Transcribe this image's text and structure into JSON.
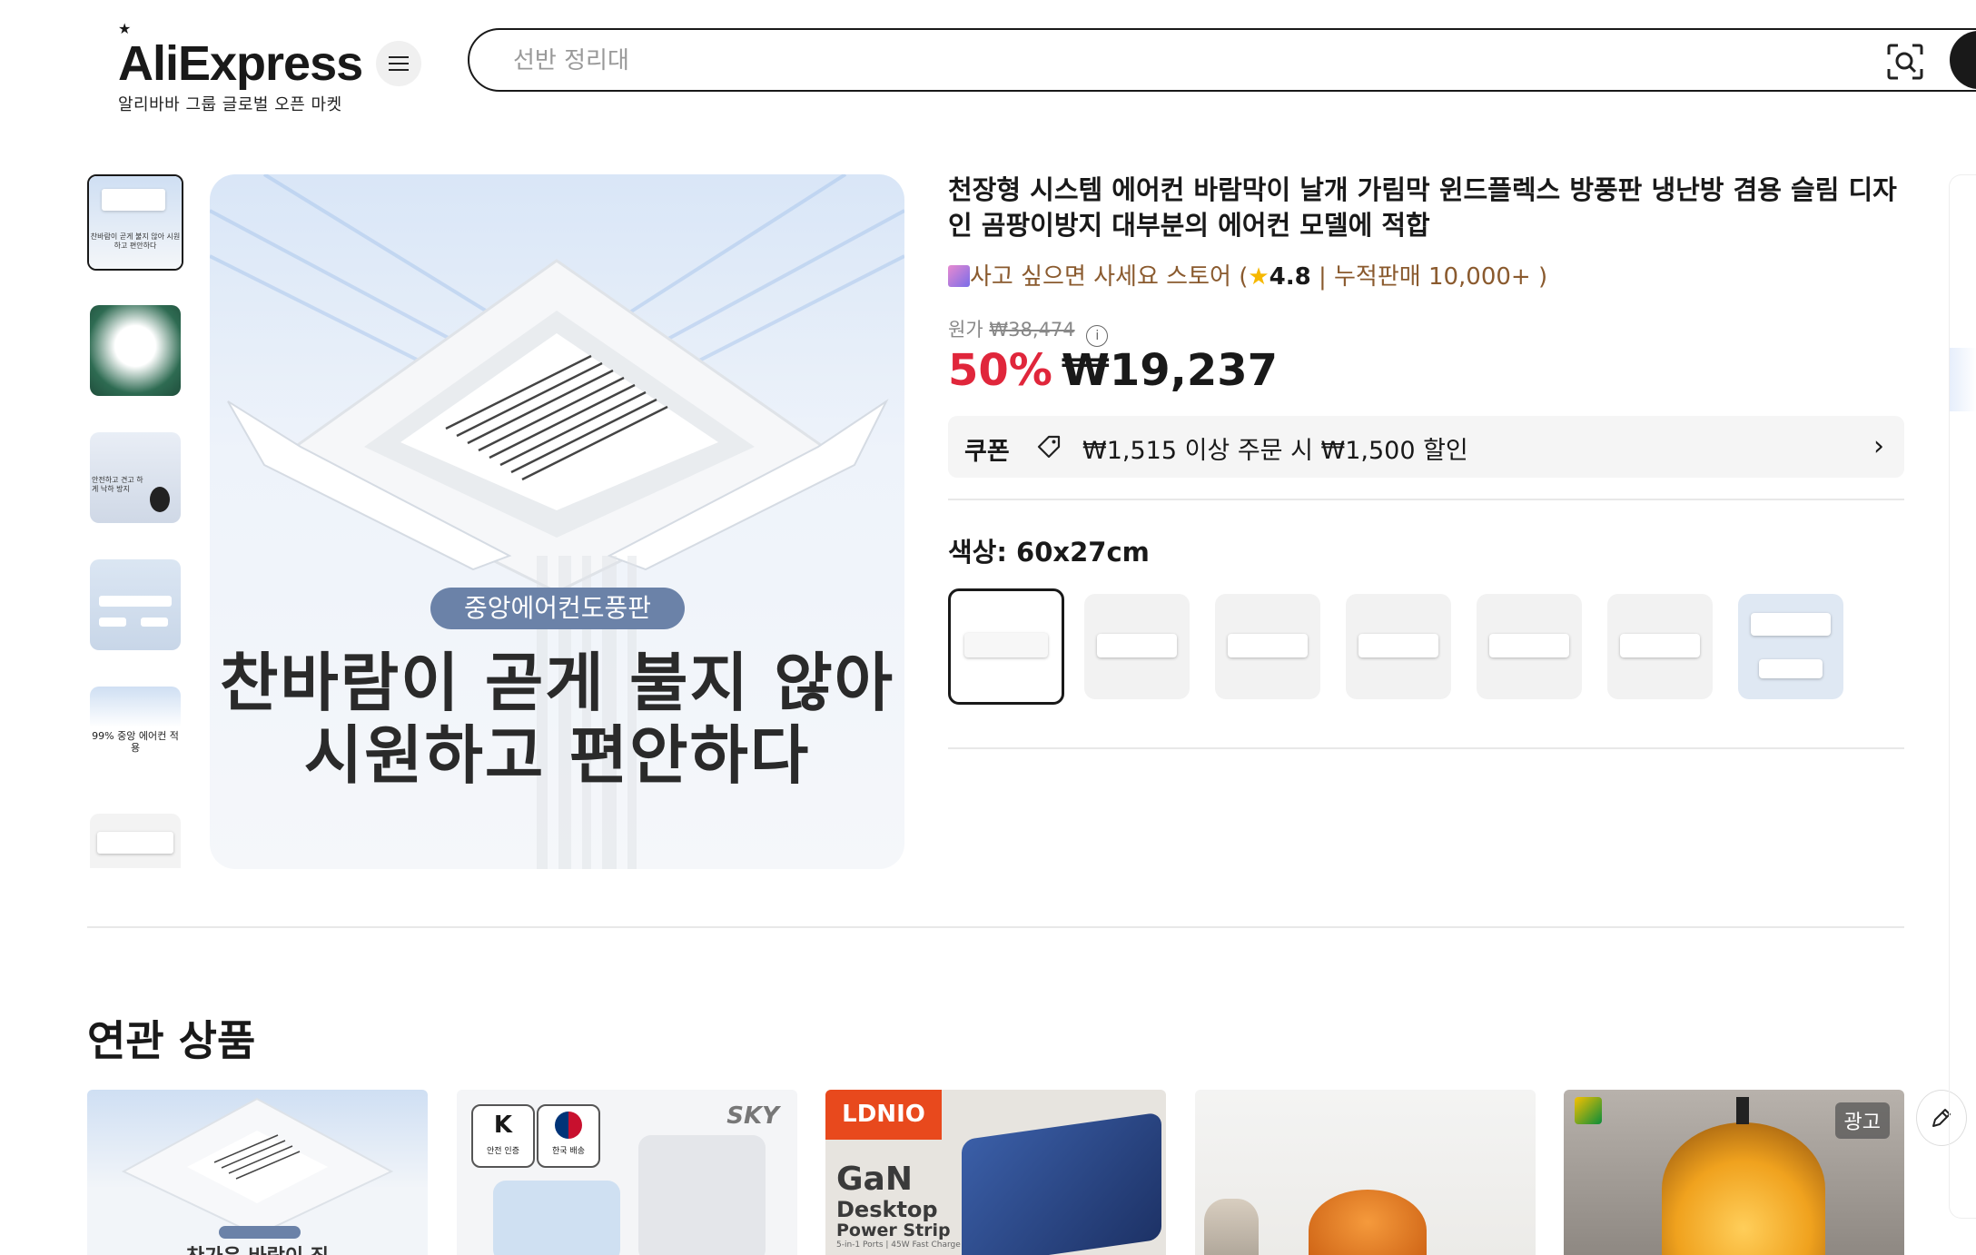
{
  "header": {
    "logo_text": "AliExpress",
    "logo_subtitle": "알리바바 그룹 글로벌 오픈 마켓",
    "search_placeholder": "선반 정리대"
  },
  "gallery": {
    "thumbnails": [
      {
        "caption": "찬바람이 곧게 불지 않아 시원하고 편안하다",
        "selected": true
      },
      {
        "caption": "",
        "selected": false
      },
      {
        "caption": "안전하고 견고 하게 낙하 방지",
        "selected": false
      },
      {
        "caption": "",
        "selected": false
      },
      {
        "caption": "99% 중앙 에어컨 적용",
        "selected": false
      },
      {
        "caption": "",
        "selected": false
      }
    ],
    "main_image": {
      "pill_text": "중앙에어컨도풍판",
      "headline_line1": "찬바람이 곧게 불지  않아",
      "headline_line2": "시원하고 편안하다"
    }
  },
  "product": {
    "title": "천장형 시스템 에어컨 바람막이 날개 가림막 윈드플렉스 방풍판 냉난방 겸용 슬림 디자인 곰팡이방지 대부분의 에어컨 모델에 적합",
    "store_name": "사고 싶으면 사세요 스토어",
    "rating": "4.8",
    "sales": "누적판매 10,000+",
    "original_price_label": "원가",
    "original_price": "₩38,474",
    "discount": "50%",
    "price": "₩19,237",
    "coupon": {
      "label": "쿠폰",
      "text": "₩1,515 이상 주문 시 ₩1,500 할인"
    },
    "color_label": "색상: 60x27cm",
    "color_options": [
      {
        "name": "60x27cm",
        "selected": true
      },
      {
        "name": "option-2",
        "selected": false
      },
      {
        "name": "option-3",
        "selected": false
      },
      {
        "name": "option-4",
        "selected": false
      },
      {
        "name": "option-5",
        "selected": false
      },
      {
        "name": "option-6",
        "selected": false
      },
      {
        "name": "option-7",
        "selected": false
      }
    ]
  },
  "related": {
    "title": "연관 상품",
    "cards": [
      {
        "brand": "",
        "headline": "찬가운 바람이 집",
        "ad": false
      },
      {
        "brand": "SKY",
        "badges": [
          "안전 인증",
          "한국 배송"
        ],
        "ad": false
      },
      {
        "brand": "LDNIO",
        "headline": "GaN",
        "sub1": "Desktop",
        "sub2": "Power Strip",
        "sub3": "5-in-1 Ports | 45W Fast Charge",
        "ad": false
      },
      {
        "brand": "",
        "ad": false
      },
      {
        "brand": "",
        "ad": true,
        "ad_label": "광고"
      }
    ]
  },
  "colors": {
    "accent_red": "#e0263b",
    "store_brown": "#8a5a2e",
    "star_yellow": "#f6b800"
  }
}
